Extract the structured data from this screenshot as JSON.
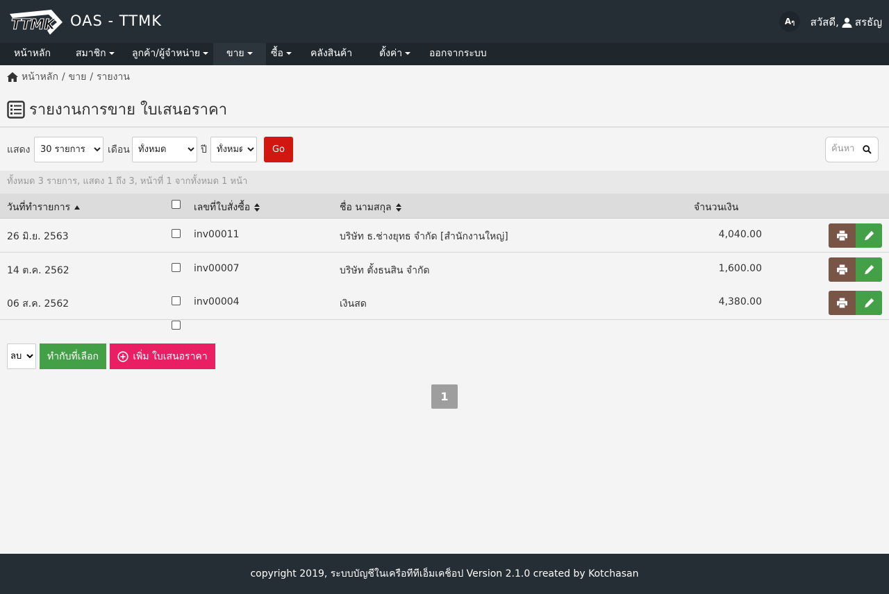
{
  "header": {
    "logo_text": "TTMK",
    "app_title": "OAS - TTMK",
    "lang_button": "A",
    "greeting": "สวัสดี,",
    "user_name": "สรธัญ"
  },
  "nav": {
    "items": [
      {
        "label": "หน้าหลัก",
        "dropdown": false
      },
      {
        "label": "สมาชิก",
        "dropdown": true
      },
      {
        "label": "ลูกค้า/ผู้จำหน่าย",
        "dropdown": true
      },
      {
        "label": "ขาย",
        "dropdown": true,
        "active": true
      },
      {
        "label": "ซื้อ",
        "dropdown": true
      },
      {
        "label": "คลังสินค้า",
        "dropdown": false
      },
      {
        "label": "ตั้งค่า",
        "dropdown": true
      },
      {
        "label": "ออกจากระบบ",
        "dropdown": false
      }
    ]
  },
  "breadcrumb": {
    "home": "หน้าหลัก",
    "sep1": "/",
    "section": "ขาย",
    "sep2": "/",
    "current": "รายงาน"
  },
  "page": {
    "title": "รายงานการขาย ใบเสนอราคา"
  },
  "filters": {
    "show_label": "แสดง",
    "show_value": "30 รายการ",
    "month_label": "เดือน",
    "month_value": "ทั้งหมด",
    "year_label": "ปี",
    "year_value": "ทั้งหมด",
    "go_label": "Go",
    "search_placeholder": "ค้นหา"
  },
  "summary": "ทั้งหมด 3 รายการ, แสดง 1 ถึง 3, หน้าที่ 1 จากทั้งหมด 1 หน้า",
  "table": {
    "columns": {
      "date": "วันที่ทำรายการ",
      "order_no": "เลขที่ใบสั่งซื้อ",
      "name": "ชื่อ นามสกุล",
      "amount": "จำนวนเงิน"
    },
    "rows": [
      {
        "date": "26 มิ.ย. 2563",
        "order_no": "inv00011",
        "name": "บริษัท ธ.ช่างยุทธ จำกัด [สำนักงานใหญ่]",
        "amount": "4,040.00"
      },
      {
        "date": "14 ต.ค. 2562",
        "order_no": "inv00007",
        "name": "บริษัท ตั้งธนสิน จำกัด",
        "amount": "1,600.00"
      },
      {
        "date": "06 ส.ค. 2562",
        "order_no": "inv00004",
        "name": "เงินสด",
        "amount": "4,380.00"
      }
    ]
  },
  "actions": {
    "bulk_value": "ลบ",
    "apply_label": "ทำกับที่เลือก",
    "add_label": "เพิ่ม ใบเสนอราคา"
  },
  "pagination": {
    "current": "1"
  },
  "footer": "copyright 2019, ระบบบัญชีในเครือทีทีเอ็มเคช็อป Version 2.1.0 created by Kotchasan",
  "colors": {
    "header_bg": "#262e35",
    "nav_bg": "#1f272d",
    "go_button": "#d1170f",
    "apply_button": "#43a047",
    "add_button": "#e91e63",
    "print_button": "#795548",
    "edit_button": "#43a047"
  }
}
